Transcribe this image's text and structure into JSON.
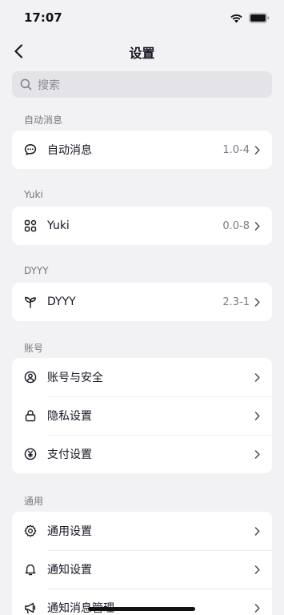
{
  "status_bar": {
    "time": "17:07"
  },
  "header": {
    "title": "设置"
  },
  "search": {
    "placeholder": "搜索"
  },
  "sections": {
    "auto_msg": {
      "label": "自动消息",
      "items": [
        {
          "label": "自动消息",
          "value": "1.0-4",
          "icon": "chat-bubble-icon"
        }
      ]
    },
    "yuki": {
      "label": "Yuki",
      "items": [
        {
          "label": "Yuki",
          "value": "0.0-8",
          "icon": "apps-grid-icon"
        }
      ]
    },
    "dyyy": {
      "label": "DYYY",
      "items": [
        {
          "label": "DYYY",
          "value": "2.3-1",
          "icon": "sprout-icon"
        }
      ]
    },
    "account": {
      "label": "账号",
      "items": [
        {
          "label": "账号与安全",
          "icon": "user-circle-icon"
        },
        {
          "label": "隐私设置",
          "icon": "lock-icon"
        },
        {
          "label": "支付设置",
          "icon": "yen-coin-icon"
        }
      ]
    },
    "general": {
      "label": "通用",
      "items": [
        {
          "label": "通用设置",
          "icon": "gear-icon"
        },
        {
          "label": "通知设置",
          "icon": "bell-icon"
        },
        {
          "label": "通知消息管理",
          "icon": "megaphone-icon"
        }
      ]
    }
  },
  "colors": {
    "background": "#f2f2f4",
    "card": "#ffffff",
    "text": "#161823",
    "secondary_text": "#7a7c85"
  }
}
